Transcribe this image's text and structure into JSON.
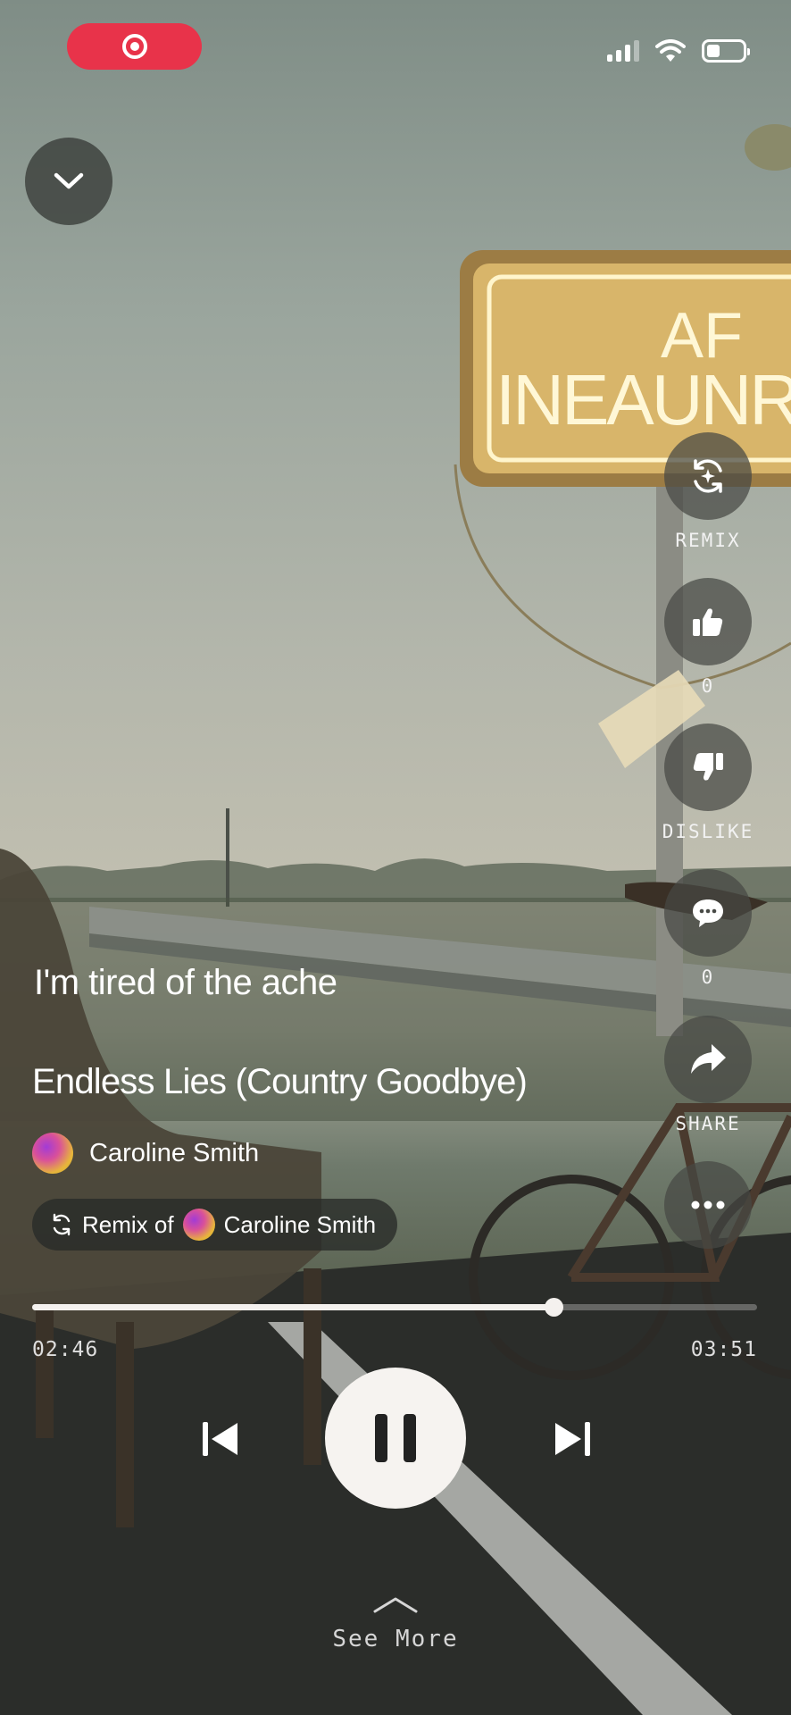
{
  "status_bar": {
    "recording_icon": "record-icon",
    "signal_icon": "cellular-signal-icon",
    "wifi_icon": "wifi-icon",
    "battery_icon": "battery-icon"
  },
  "header": {
    "collapse_icon": "chevron-down-icon"
  },
  "actions": {
    "remix": {
      "icon": "remix-sparkle-icon",
      "label": "REMIX"
    },
    "like": {
      "icon": "thumbs-up-icon",
      "count": "0"
    },
    "dislike": {
      "icon": "thumbs-down-icon",
      "label": "DISLIKE"
    },
    "comment": {
      "icon": "comment-bubble-icon",
      "count": "0"
    },
    "share": {
      "icon": "share-arrow-icon",
      "label": "SHARE"
    },
    "more": {
      "icon": "more-dots-icon"
    }
  },
  "track": {
    "lyric_line": "I'm tired of the ache",
    "title": "Endless Lies (Country Goodbye)",
    "artist": "Caroline Smith",
    "remix_prefix": "Remix of",
    "remix_artist": "Caroline Smith"
  },
  "progress": {
    "elapsed": "02:46",
    "duration": "03:51",
    "fraction": 0.719
  },
  "controls": {
    "previous_icon": "skip-previous-icon",
    "pause_icon": "pause-icon",
    "next_icon": "skip-next-icon"
  },
  "footer": {
    "see_more_label": "See More",
    "see_more_icon": "chevron-up-icon"
  },
  "colors": {
    "record_pill": "#e8334a",
    "progress_fill": "#f4f1ee",
    "play_button": "#f6f3f0"
  }
}
